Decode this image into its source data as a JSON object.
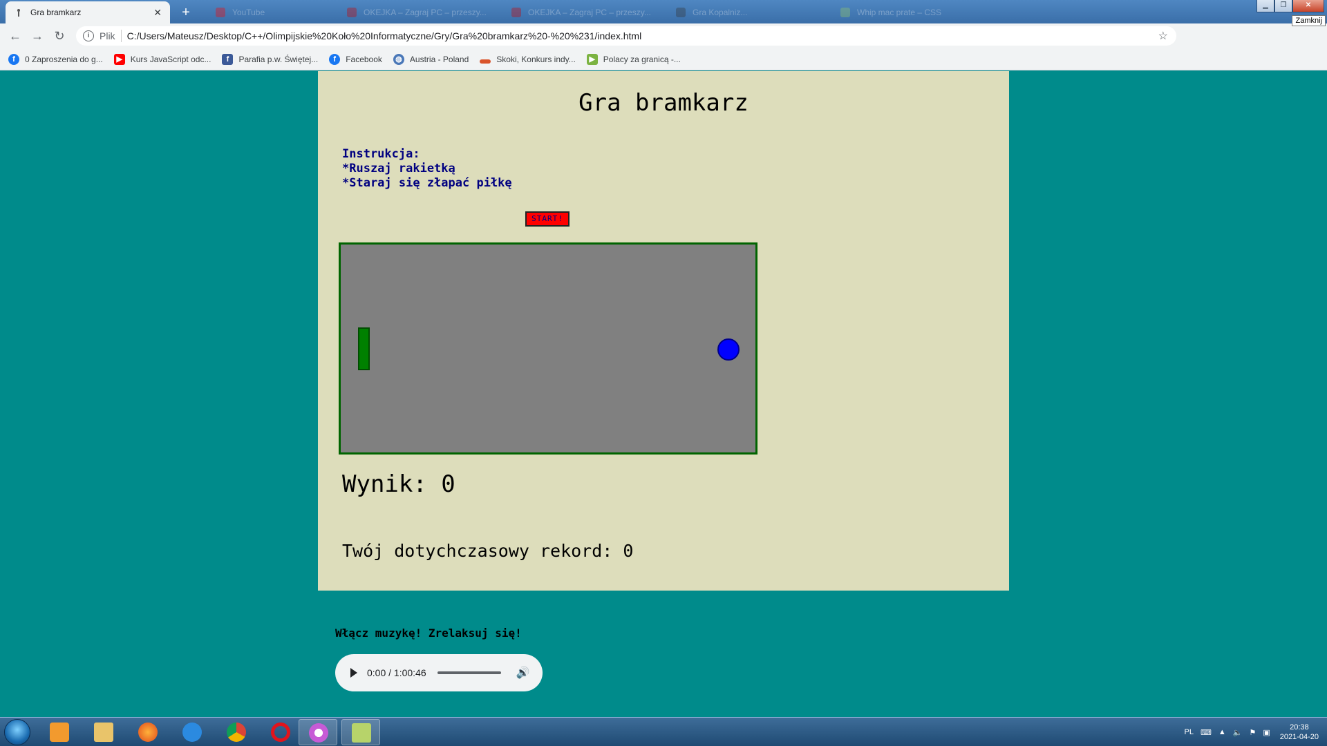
{
  "browser": {
    "active_tab": {
      "title": "Gra bramkarz"
    },
    "background_tabs": [
      "YouTube",
      "OKEJKA – Zagraj PC – przeszy...",
      "OKEJKA – Zagraj PC – przeszy...",
      "Gra Kopalniz...",
      "Whip mac prate – CSS"
    ],
    "tooltip": "Zamknij",
    "address": {
      "scheme_label": "Plik",
      "url": "C:/Users/Mateusz/Desktop/C++/Olimpijskie%20Koło%20Informatyczne/Gry/Gra%20bramkarz%20-%20%231/index.html"
    },
    "bookmarks": [
      {
        "label": "0 Zaproszenia do g...",
        "icon": "facebook-icon",
        "color": "#1877f2"
      },
      {
        "label": "Kurs JavaScript odc...",
        "icon": "youtube-icon",
        "color": "#ff0000"
      },
      {
        "label": "Parafia p.w. Świętej...",
        "icon": "facebook-icon",
        "color": "#3b5998"
      },
      {
        "label": "Facebook",
        "icon": "facebook-icon",
        "color": "#1877f2"
      },
      {
        "label": "Austria - Poland",
        "icon": "globe-icon",
        "color": "#4a78b8"
      },
      {
        "label": "Skoki, Konkurs indy...",
        "icon": "ski-icon",
        "color": "#d9542b"
      },
      {
        "label": "Polacy za granicą -...",
        "icon": "play-icon",
        "color": "#7cb342"
      }
    ]
  },
  "game": {
    "title": "Gra bramkarz",
    "instructions": [
      "Instrukcja:",
      "*Ruszaj rakietką",
      "*Staraj się złapać piłkę"
    ],
    "start_label": "START!",
    "score_label": "Wynik: 0",
    "record_label": "Twój dotychczasowy rekord: 0",
    "colors": {
      "panel": "#ddddbb",
      "field": "#808080",
      "paddle": "#008000",
      "ball": "#0000ff",
      "start": "#ff0000",
      "page": "#008b8b"
    }
  },
  "music": {
    "label": "Włącz muzykę! Zrelaksuj się!",
    "time": "0:00 / 1:00:46"
  },
  "taskbar": {
    "language": "PL",
    "time": "20:38",
    "date": "2021-04-20"
  }
}
